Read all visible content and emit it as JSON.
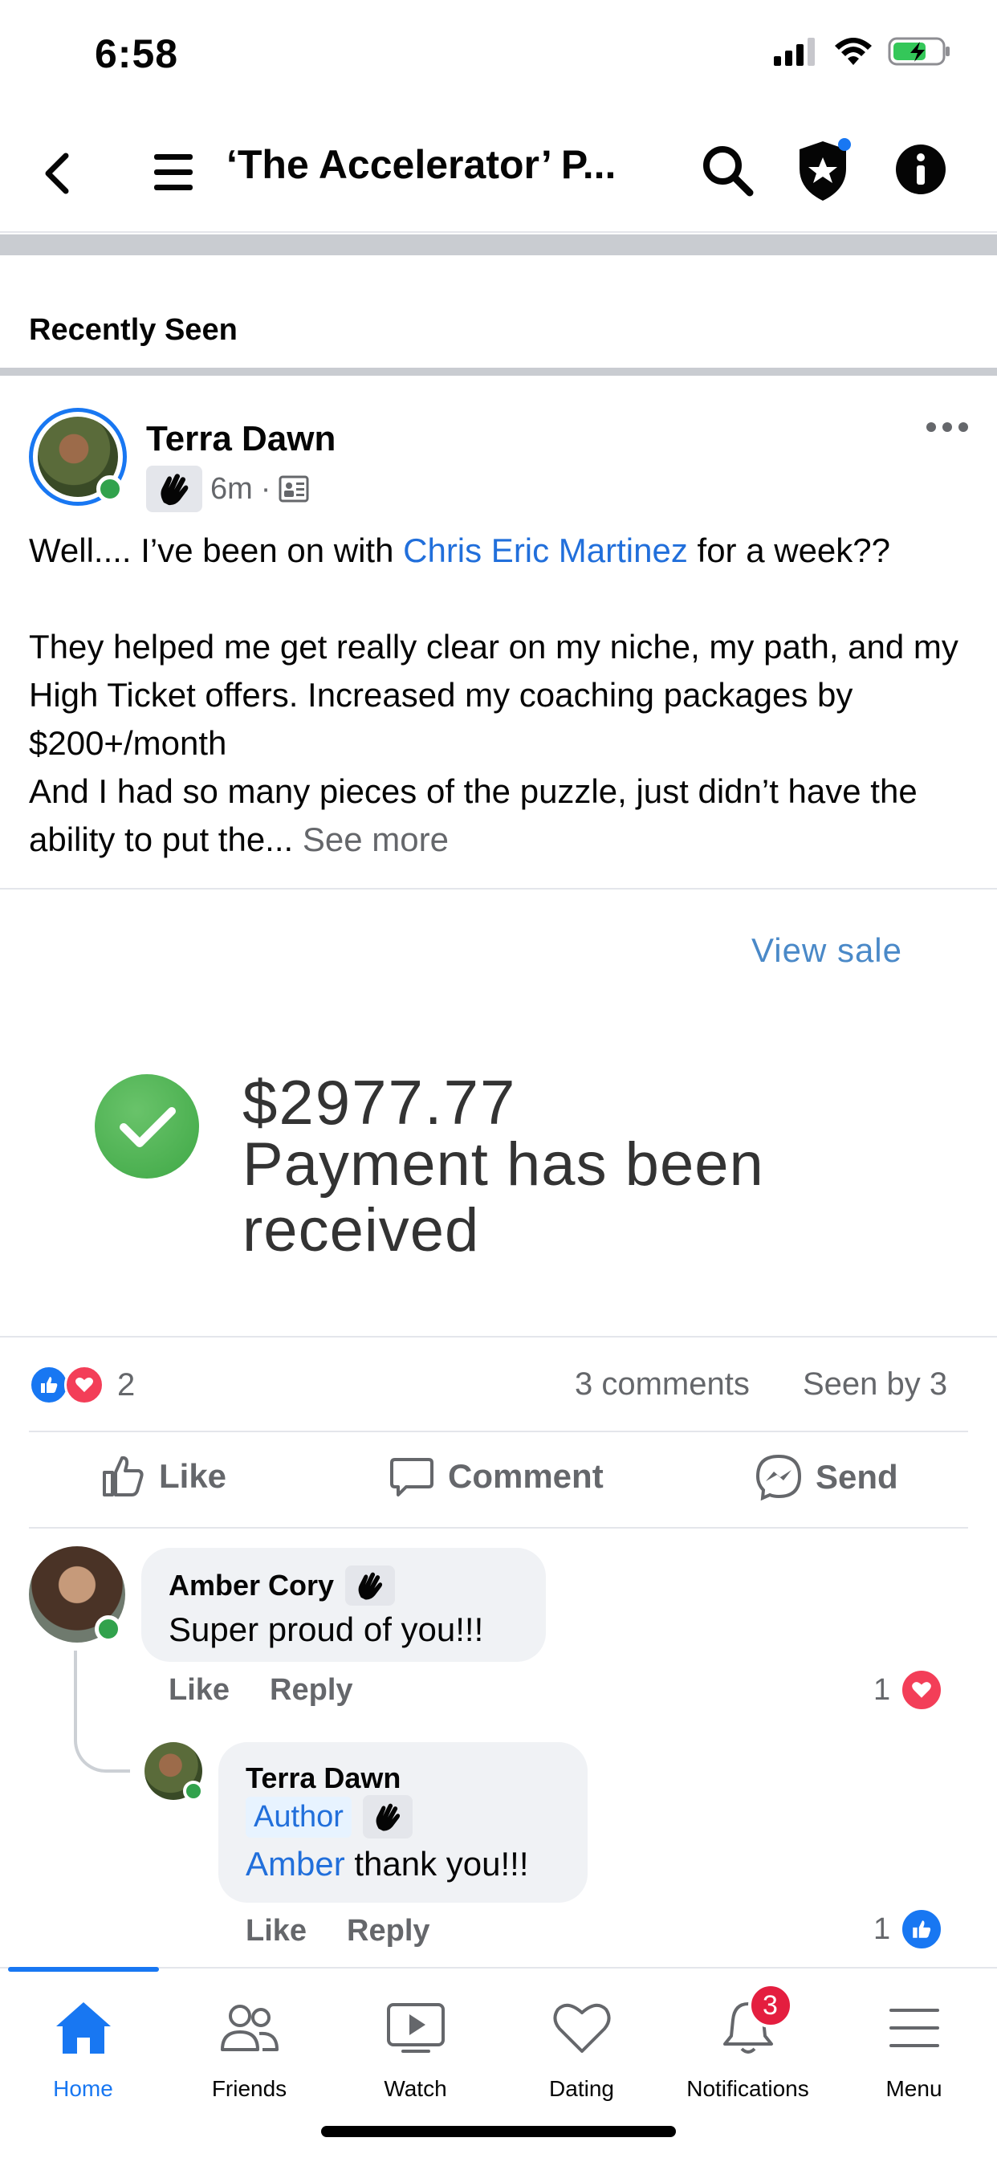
{
  "status_bar": {
    "time": "6:58"
  },
  "nav": {
    "title": "‘The Accelerator’ P..."
  },
  "section": {
    "title": "Recently Seen"
  },
  "post": {
    "author": "Terra Dawn",
    "time": "6m",
    "separator": "·",
    "text_before_link": "Well.... I’ve been on with ",
    "mention": "Chris Eric Martinez",
    "text_after_link": " for a week??",
    "para2": "They helped me get really clear on my niche, my path, and my High Ticket offers. Increased my coaching packages by $200+/month",
    "para3": "And I had so many pieces of the puzzle, just didn’t have the ability to put the...",
    "see_more": "See more",
    "image": {
      "view_sale": "View sale",
      "amount": "$2977.77",
      "message": "Payment has been received"
    },
    "reaction_count": "2",
    "comment_count": "3 comments",
    "seen_by": "Seen by 3",
    "actions": {
      "like": "Like",
      "comment": "Comment",
      "send": "Send"
    }
  },
  "comments": [
    {
      "name": "Amber Cory",
      "text": "Super proud of you!!!",
      "like": "Like",
      "reply": "Reply",
      "reaction_count": "1"
    },
    {
      "name": "Terra Dawn",
      "badge": "Author",
      "mention": "Amber",
      "text": " thank you!!!",
      "like": "Like",
      "reply": "Reply",
      "reaction_count": "1"
    }
  ],
  "tabs": [
    {
      "label": "Home",
      "icon": "home-icon"
    },
    {
      "label": "Friends",
      "icon": "friends-icon"
    },
    {
      "label": "Watch",
      "icon": "watch-icon"
    },
    {
      "label": "Dating",
      "icon": "heart-icon"
    },
    {
      "label": "Notifications",
      "icon": "bell-icon",
      "badge": "3"
    },
    {
      "label": "Menu",
      "icon": "menu-icon"
    }
  ],
  "colors": {
    "accent": "#1877f2",
    "online": "#31a24c",
    "love": "#f33e58",
    "badge": "#e41e3f"
  }
}
